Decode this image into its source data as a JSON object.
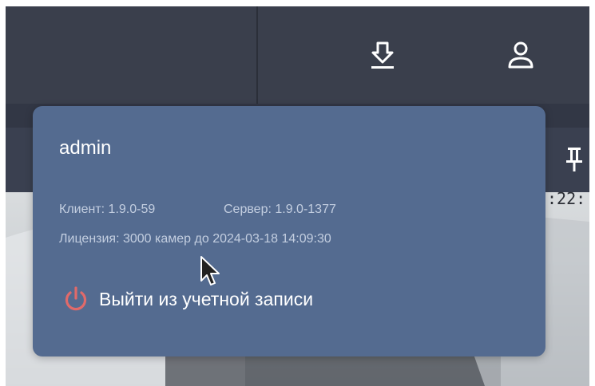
{
  "header": {
    "download_icon": "download-icon",
    "user_icon": "user-icon"
  },
  "camera": {
    "timestamp": ":22:",
    "pin_icon": "pin-icon"
  },
  "popup": {
    "username": "admin",
    "client_label": "Клиент: 1.9.0-59",
    "server_label": "Сервер: 1.9.0-1377",
    "license_label": "Лицензия: 3000 камер до 2024-03-18 14:09:30",
    "logout_label": "Выйти из учетной записи",
    "logout_icon": "power-icon",
    "logout_color": "#e06a6a"
  },
  "colors": {
    "topbar": "#3a3f4c",
    "popup_bg": "#546b90",
    "info_text": "#c3cee0"
  }
}
